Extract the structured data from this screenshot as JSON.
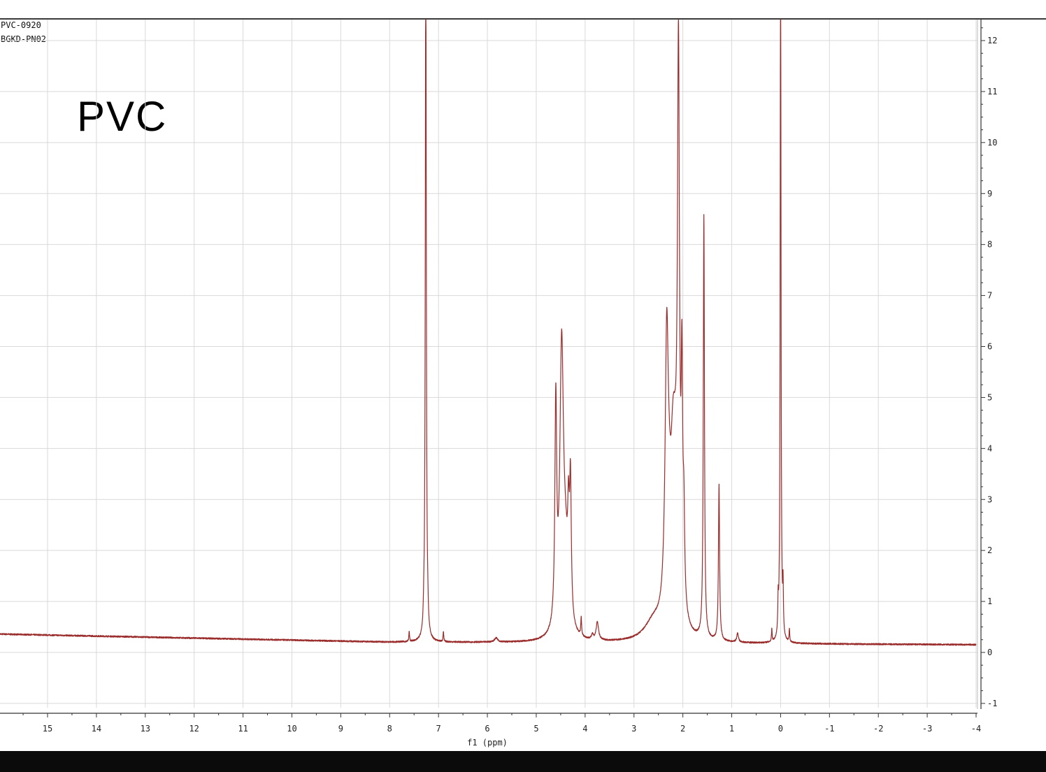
{
  "header": {
    "sample_id": "PVC-0920",
    "instrument_id": "BGKD-PN02"
  },
  "annotation": {
    "label": "PVC"
  },
  "colors": {
    "trace": "#9b2c2c",
    "grid": "#d9d9d9",
    "axis": "#333333"
  },
  "chart_data": {
    "type": "line",
    "title": "",
    "xlabel": "f1 (ppm)",
    "ylabel": "",
    "xlim": [
      16,
      -4
    ],
    "ylim": [
      -1.05,
      12.5
    ],
    "x_reversed": true,
    "x_ticks": [
      15,
      14,
      13,
      12,
      11,
      10,
      9,
      8,
      7,
      6,
      5,
      4,
      3,
      2,
      1,
      0,
      -1,
      -2,
      -3,
      -4
    ],
    "x_tick_labels": [
      "15",
      "14",
      "13",
      "12",
      "11",
      "10",
      "9",
      "8",
      "7",
      "6",
      "5",
      "4",
      "3",
      "2",
      "1",
      "0",
      "-1",
      "-2",
      "-3",
      "-4"
    ],
    "y_ticks": [
      12,
      11,
      10,
      9,
      8,
      7,
      6,
      5,
      4,
      3,
      2,
      1,
      0,
      -1
    ],
    "y_tick_labels": [
      "12",
      "11",
      "10",
      "9",
      "8",
      "7",
      "6",
      "5",
      "4",
      "3",
      "2",
      "1",
      "0",
      "-1"
    ],
    "y_axis_side": "right",
    "grid": true,
    "series": [
      {
        "peaks": [
          {
            "x": 7.26,
            "h": 14.0,
            "w": 0.012
          },
          {
            "x": 7.3,
            "h": 0.25,
            "w": 0.01
          },
          {
            "x": 7.22,
            "h": 0.25,
            "w": 0.01
          },
          {
            "x": 7.6,
            "h": 0.2,
            "w": 0.008
          },
          {
            "x": 6.9,
            "h": 0.2,
            "w": 0.008
          },
          {
            "x": 5.82,
            "h": 0.08,
            "w": 0.04
          },
          {
            "x": 4.6,
            "h": 4.3,
            "w": 0.022
          },
          {
            "x": 4.48,
            "h": 5.5,
            "w": 0.045
          },
          {
            "x": 4.34,
            "h": 1.6,
            "w": 0.02
          },
          {
            "x": 4.3,
            "h": 2.6,
            "w": 0.02
          },
          {
            "x": 4.4,
            "h": 1.2,
            "w": 0.06
          },
          {
            "x": 4.08,
            "h": 0.35,
            "w": 0.01
          },
          {
            "x": 3.75,
            "h": 0.35,
            "w": 0.03
          },
          {
            "x": 3.85,
            "h": 0.1,
            "w": 0.02
          },
          {
            "x": 2.6,
            "h": 0.35,
            "w": 0.22
          },
          {
            "x": 2.33,
            "h": 5.2,
            "w": 0.04
          },
          {
            "x": 2.28,
            "h": 1.0,
            "w": 0.05
          },
          {
            "x": 2.2,
            "h": 2.8,
            "w": 0.06
          },
          {
            "x": 2.09,
            "h": 10.5,
            "w": 0.025
          },
          {
            "x": 2.02,
            "h": 4.2,
            "w": 0.018
          },
          {
            "x": 1.98,
            "h": 1.7,
            "w": 0.02
          },
          {
            "x": 2.15,
            "h": 1.3,
            "w": 0.05
          },
          {
            "x": 1.57,
            "h": 8.3,
            "w": 0.014
          },
          {
            "x": 1.26,
            "h": 3.05,
            "w": 0.014
          },
          {
            "x": 0.88,
            "h": 0.18,
            "w": 0.02
          },
          {
            "x": 0.0,
            "h": 14.0,
            "w": 0.01
          },
          {
            "x": 0.05,
            "h": 0.6,
            "w": 0.008
          },
          {
            "x": -0.05,
            "h": 0.9,
            "w": 0.008
          },
          {
            "x": 0.18,
            "h": 0.25,
            "w": 0.008
          },
          {
            "x": -0.18,
            "h": 0.25,
            "w": 0.008
          }
        ],
        "baseline": {
          "x_at_16": 0.36,
          "x_at_8": 0.2,
          "x_at_-4": 0.15
        }
      }
    ]
  }
}
